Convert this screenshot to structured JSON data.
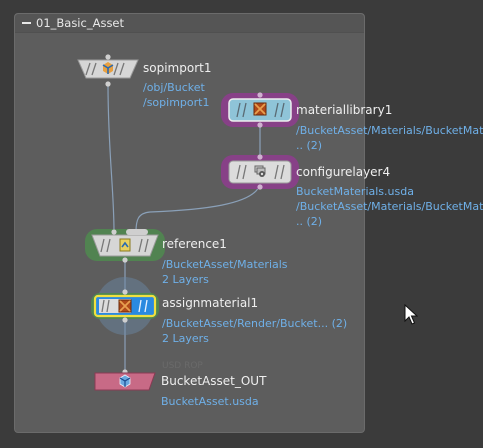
{
  "netbox": {
    "title": "01_Basic_Asset"
  },
  "nodes": {
    "sopimport": {
      "name": "sopimport1",
      "sub": [
        "/obj/Bucket",
        "/sopimport1"
      ]
    },
    "materiallibrary": {
      "name": "materiallibrary1",
      "sub": [
        "/BucketAsset/Materials/BucketMat",
        ".. (2)"
      ]
    },
    "configurelayer": {
      "name": "configurelayer4",
      "sub": [
        "BucketMaterials.usda",
        "/BucketAsset/Materials/BucketMat",
        ".. (2)"
      ]
    },
    "reference": {
      "name": "reference1",
      "sub": [
        "/BucketAsset/Materials",
        "2 Layers"
      ]
    },
    "assignmaterial": {
      "name": "assignmaterial1",
      "sub": [
        "/BucketAsset/Render/Bucket... (2)",
        "2 Layers"
      ]
    },
    "rop": {
      "name": "BucketAsset_OUT",
      "faint_label": "USD ROP",
      "sub": [
        "BucketAsset.usda"
      ]
    }
  },
  "icons": {
    "sopimport": "sop-import-icon",
    "materiallibrary": "material-box-icon",
    "configurelayer": "configure-layer-gear-icon",
    "reference": "reference-icon",
    "assignmaterial": "assign-material-box-icon",
    "rop": "usd-rop-icon"
  },
  "colors": {
    "wire": "#8aa0b8",
    "node_body": "#dcdcdc",
    "purple_ring": "#9a4a9a",
    "green_ring": "#4f8a4f",
    "selected_yellow": "#f0e040",
    "selected_blue": "#2a8ae0",
    "rop_pink": "#c86a86",
    "link_text": "#6fb0e8"
  }
}
